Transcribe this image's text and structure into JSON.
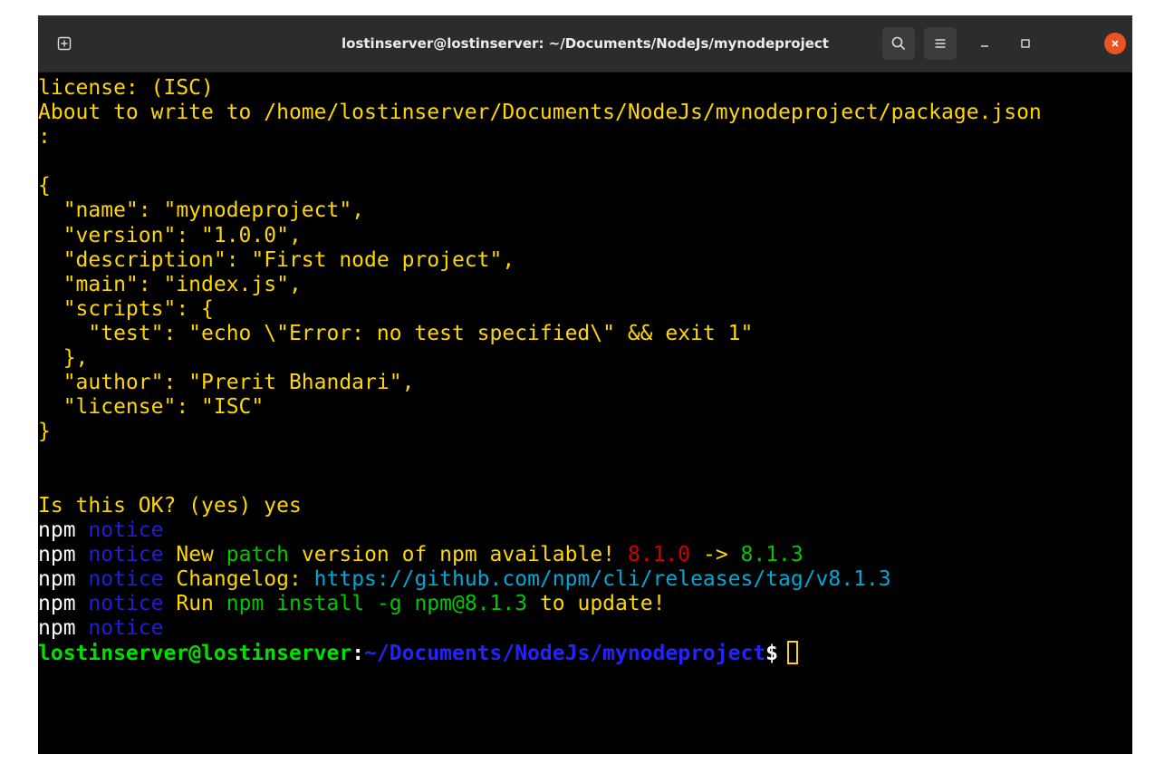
{
  "window": {
    "title": "lostinserver@lostinserver: ~/Documents/NodeJs/mynodeproject"
  },
  "titlebar_icons": [
    "new-tab-icon",
    "search-icon",
    "hamburger-menu-icon",
    "minimize-icon",
    "maximize-icon",
    "close-icon"
  ],
  "colors": {
    "terminal_bg": "#000000",
    "text_yellow": "#ffd700",
    "npm_notice_blue": "#1f1fd6",
    "green": "#00c800",
    "red": "#d00000",
    "cyan_link": "#00a8d6",
    "close_button": "#e95420"
  },
  "terminal": {
    "lines": [
      "license: (ISC)",
      "About to write to /home/lostinserver/Documents/NodeJs/mynodeproject/package.json",
      ":",
      "",
      "{",
      "  \"name\": \"mynodeproject\",",
      "  \"version\": \"1.0.0\",",
      "  \"description\": \"First node project\",",
      "  \"main\": \"index.js\",",
      "  \"scripts\": {",
      "    \"test\": \"echo \\\"Error: no test specified\\\" && exit 1\"",
      "  },",
      "  \"author\": \"Prerit Bhandari\",",
      "  \"license\": \"ISC\"",
      "}",
      "",
      "",
      "Is this OK? (yes) yes"
    ],
    "npm_lines": {
      "n1": {
        "npm": "npm",
        "notice": "notice"
      },
      "n2": {
        "npm": "npm",
        "notice": "notice",
        "t1": " New ",
        "t2": "patch",
        "t3": " version of npm available! ",
        "old": "8.1.0",
        "arrow": " -> ",
        "new": "8.1.3"
      },
      "n3": {
        "npm": "npm",
        "notice": "notice",
        "t1": " Changelog: ",
        "link": "https://github.com/npm/cli/releases/tag/v8.1.3"
      },
      "n4": {
        "npm": "npm",
        "notice": "notice",
        "t1": " Run ",
        "cmd": "npm install -g npm@8.1.3",
        "t2": " to update!"
      },
      "n5": {
        "npm": "npm",
        "notice": "notice"
      }
    },
    "prompt": {
      "user_host": "lostinserver@lostinserver",
      "colon": ":",
      "path": "~/Documents/NodeJs/mynodeproject",
      "dollar": "$"
    }
  }
}
